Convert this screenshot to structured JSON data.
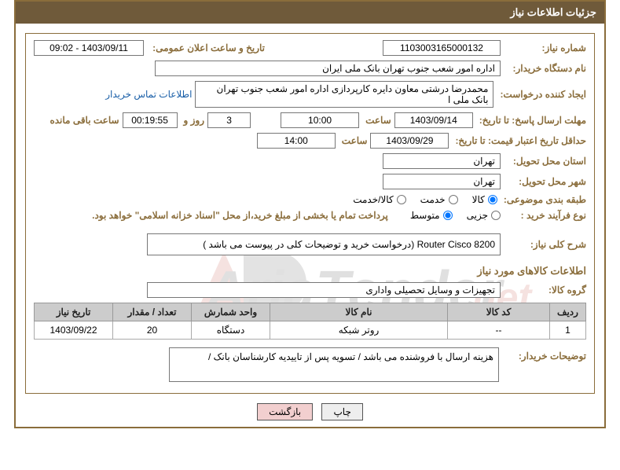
{
  "title": "جزئیات اطلاعات نیاز",
  "labels": {
    "need_no": "شماره نیاز:",
    "announce_dt": "تاریخ و ساعت اعلان عمومی:",
    "buyer_org": "نام دستگاه خریدار:",
    "requester": "ایجاد کننده درخواست:",
    "contact_link": "اطلاعات تماس خریدار",
    "resp_deadline": "مهلت ارسال پاسخ: تا تاریخ:",
    "time": "ساعت",
    "days_and": "روز و",
    "remaining": "ساعت باقی مانده",
    "price_valid": "حداقل تاریخ اعتبار قیمت: تا تاریخ:",
    "delivery_prov": "استان محل تحویل:",
    "delivery_city": "شهر محل تحویل:",
    "subject_cat": "طبقه بندی موضوعی:",
    "purchase_type": "نوع فرآیند خرید :",
    "payment_note": "پرداخت تمام یا بخشی از مبلغ خرید،از محل \"اسناد خزانه اسلامی\" خواهد بود.",
    "overall_desc": "شرح کلی نیاز:",
    "goods_info": "اطلاعات کالاهای مورد نیاز",
    "goods_group": "گروه کالا:",
    "buyer_notes": "توضیحات خریدار:",
    "btn_print": "چاپ",
    "btn_back": "بازگشت"
  },
  "values": {
    "need_no": "1103003165000132",
    "announce_dt": "1403/09/11 - 09:02",
    "buyer_org": "اداره امور شعب جنوب تهران بانک ملی ایران",
    "requester": "محمدرضا درشتی معاون دایره کارپردازی اداره امور شعب جنوب تهران بانک ملی ا",
    "resp_date": "1403/09/14",
    "resp_time": "10:00",
    "days_left": "3",
    "time_left": "00:19:55",
    "price_valid_date": "1403/09/29",
    "price_valid_time": "14:00",
    "province": "تهران",
    "city": "تهران",
    "overall_desc": "Router  Cisco  8200 (درخواست خرید و توضیحات کلی در پیوست می باشد )",
    "goods_group": "تجهیزات و وسایل تحصیلی واداری",
    "buyer_notes": "هزینه ارسال با فروشنده می باشد / تسویه پس از تاییدیه کارشناسان بانک /"
  },
  "radios": {
    "cat": {
      "goods": "کالا",
      "service": "خدمت",
      "both": "کالا/خدمت",
      "selected": "goods"
    },
    "ptype": {
      "partial": "جزیی",
      "medium": "متوسط",
      "selected": "medium"
    }
  },
  "table": {
    "headers": {
      "row": "ردیف",
      "code": "کد کالا",
      "name": "نام کالا",
      "unit": "واحد شمارش",
      "qty": "تعداد / مقدار",
      "need_date": "تاریخ نیاز"
    },
    "rows": [
      {
        "row": "1",
        "code": "--",
        "name": "روتر شبکه",
        "unit": "دستگاه",
        "qty": "20",
        "need_date": "1403/09/22"
      }
    ]
  },
  "watermark_text": "AriaTender.net"
}
